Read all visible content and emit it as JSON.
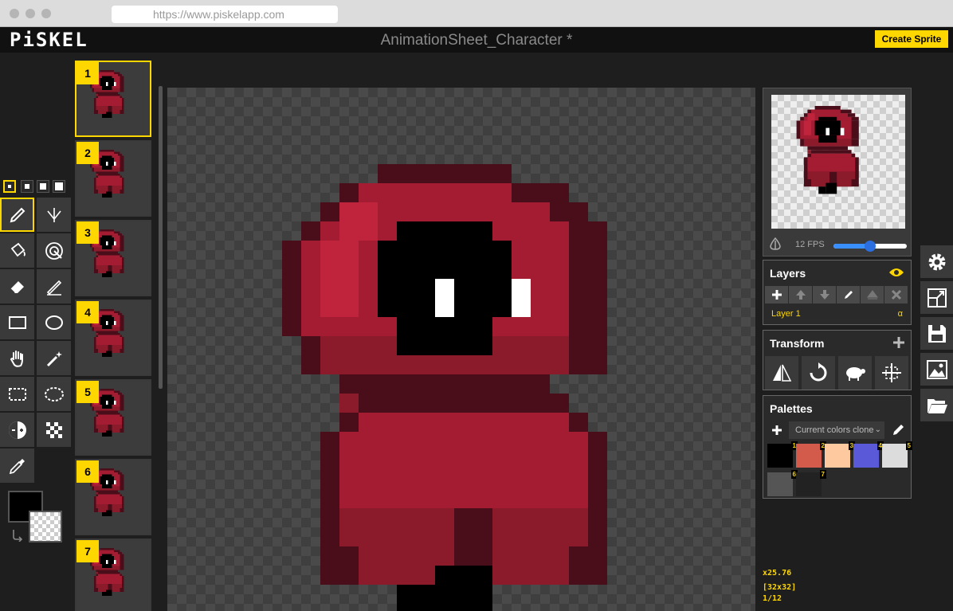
{
  "browser": {
    "url": "https://www.piskelapp.com"
  },
  "app": {
    "logo": "PiSKEL",
    "document_title": "AnimationSheet_Character *",
    "create_sprite_label": "Create Sprite"
  },
  "tools": {
    "pen_sizes": [
      "1",
      "2",
      "3",
      "4"
    ],
    "selected_pen_size": "1",
    "items": [
      {
        "name": "pen-tool-button",
        "icon": "pen-icon",
        "selected": true
      },
      {
        "name": "mirror-pen-tool-button",
        "icon": "vertical-mirror-pen-icon",
        "selected": false
      },
      {
        "name": "paint-bucket-tool-button",
        "icon": "paint-bucket-icon",
        "selected": false
      },
      {
        "name": "paint-same-color-tool-button",
        "icon": "paint-all-same-color-icon",
        "selected": false
      },
      {
        "name": "eraser-tool-button",
        "icon": "eraser-icon",
        "selected": false
      },
      {
        "name": "stroke-tool-button",
        "icon": "stroke-icon",
        "selected": false
      },
      {
        "name": "rectangle-tool-button",
        "icon": "rectangle-icon",
        "selected": false
      },
      {
        "name": "ellipse-tool-button",
        "icon": "ellipse-icon",
        "selected": false
      },
      {
        "name": "move-tool-button",
        "icon": "hand-icon",
        "selected": false
      },
      {
        "name": "shape-select-tool-button",
        "icon": "magic-wand-icon",
        "selected": false
      },
      {
        "name": "rectangle-select-tool-button",
        "icon": "rectangle-select-icon",
        "selected": false
      },
      {
        "name": "lasso-select-tool-button",
        "icon": "lasso-select-icon",
        "selected": false
      },
      {
        "name": "lighten-tool-button",
        "icon": "lighten-darken-icon",
        "selected": false
      },
      {
        "name": "dither-tool-button",
        "icon": "dithering-icon",
        "selected": false
      },
      {
        "name": "color-picker-tool-button",
        "icon": "eyedropper-icon",
        "selected": false
      }
    ],
    "primary_color": "#000000",
    "secondary_color": "transparent"
  },
  "frames": {
    "items": [
      "1",
      "2",
      "3",
      "4",
      "5",
      "6",
      "7"
    ],
    "selected": "1"
  },
  "preview": {
    "fps_label": "12 FPS",
    "fps": 12,
    "fps_max": 24
  },
  "layers": {
    "title": "Layers",
    "items": [
      {
        "name": "Layer 1",
        "alpha_label": "α"
      }
    ]
  },
  "transform": {
    "title": "Transform"
  },
  "palettes": {
    "title": "Palettes",
    "selected_palette": "Current colors clone",
    "colors": [
      {
        "num": "1",
        "color": "#000000"
      },
      {
        "num": "2",
        "color": "#d35b4b"
      },
      {
        "num": "3",
        "color": "#ffc9a0"
      },
      {
        "num": "4",
        "color": "#5a5ad8"
      },
      {
        "num": "5",
        "color": "#dcdcdc"
      },
      {
        "num": "6",
        "color": "#555555"
      },
      {
        "num": "7",
        "color": "#222222"
      }
    ]
  },
  "status": {
    "zoom": "x25.76",
    "size": "[32x32]",
    "frame": "1/12"
  },
  "colors": {
    "accent": "#ffd700",
    "cloak_dark": "#4a0e1a",
    "cloak_mid": "#8b1a2b",
    "cloak_main": "#a31c32",
    "cloak_light": "#c0233c",
    "eye": "#ffffff"
  }
}
